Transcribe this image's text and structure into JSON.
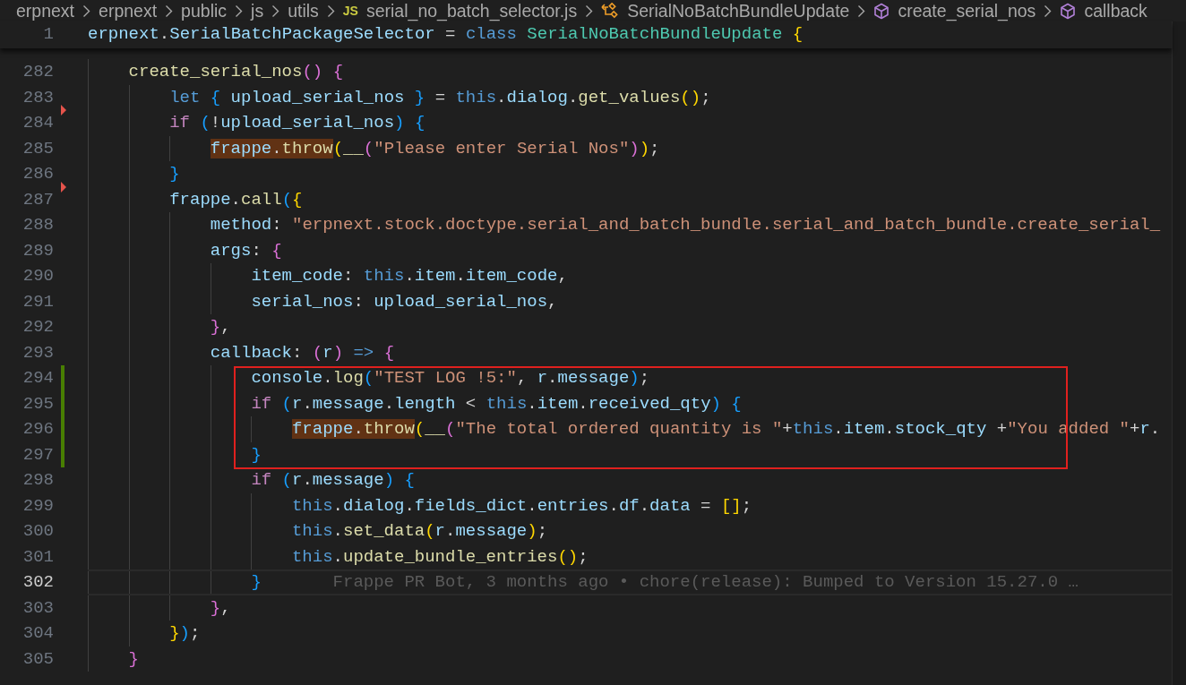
{
  "breadcrumb": [
    {
      "label": "erpnext",
      "kind": "folder"
    },
    {
      "label": "erpnext",
      "kind": "folder"
    },
    {
      "label": "public",
      "kind": "folder"
    },
    {
      "label": "js",
      "kind": "folder"
    },
    {
      "label": "utils",
      "kind": "folder"
    },
    {
      "label": "serial_no_batch_selector.js",
      "kind": "file",
      "badge": "JS"
    },
    {
      "label": "SerialNoBatchBundleUpdate",
      "kind": "class"
    },
    {
      "label": "create_serial_nos",
      "kind": "method"
    },
    {
      "label": "callback",
      "kind": "method"
    }
  ],
  "sticky_line": {
    "number": "1",
    "tokens": [
      {
        "text": "erpnext",
        "kind": "var"
      },
      {
        "text": ".",
        "kind": "op"
      },
      {
        "text": "SerialBatchPackageSelector",
        "kind": "var"
      },
      {
        "text": " = ",
        "kind": "op"
      },
      {
        "text": "class ",
        "kind": "kw"
      },
      {
        "text": "SerialNoBatchBundleUpdate ",
        "kind": "cls"
      },
      {
        "text": "{",
        "kind": "b1"
      }
    ]
  },
  "lines": [
    {
      "number": "282",
      "changed": false,
      "deleted_above": false,
      "current": false,
      "boxed": false,
      "tokens": [
        {
          "text": "create_serial_nos",
          "kind": "fn"
        },
        {
          "text": "() ",
          "kind": "b2"
        },
        {
          "text": "{",
          "kind": "b2"
        }
      ],
      "children": [
        {
          "number": "283",
          "changed": false,
          "deleted_above": false,
          "current": false,
          "boxed": false,
          "tokens": [
            {
              "text": "let ",
              "kind": "kw"
            },
            {
              "text": "{ ",
              "kind": "b3"
            },
            {
              "text": "upload_serial_nos ",
              "kind": "var"
            },
            {
              "text": "}",
              "kind": "b3"
            },
            {
              "text": " = ",
              "kind": "op"
            },
            {
              "text": "this",
              "kind": "kw"
            },
            {
              "text": ".",
              "kind": "op"
            },
            {
              "text": "dialog",
              "kind": "var"
            },
            {
              "text": ".",
              "kind": "op"
            },
            {
              "text": "get_values",
              "kind": "fn"
            },
            {
              "text": "()",
              "kind": "b1"
            },
            {
              "text": ";",
              "kind": "op"
            }
          ]
        },
        {
          "number": "284",
          "changed": false,
          "deleted_above": true,
          "current": false,
          "boxed": false,
          "tokens": [
            {
              "text": "if ",
              "kind": "ctrl"
            },
            {
              "text": "(",
              "kind": "b3"
            },
            {
              "text": "!",
              "kind": "op"
            },
            {
              "text": "upload_serial_nos",
              "kind": "var"
            },
            {
              "text": ") ",
              "kind": "b3"
            },
            {
              "text": "{",
              "kind": "b3"
            }
          ],
          "children": [
            {
              "number": "285",
              "changed": false,
              "deleted_above": false,
              "current": false,
              "boxed": false,
              "tokens": [
                {
                  "kind": "group",
                  "highlighted": true,
                  "tokens": [
                    {
                      "text": "frappe",
                      "kind": "var"
                    },
                    {
                      "text": ".",
                      "kind": "op"
                    },
                    {
                      "text": "throw",
                      "kind": "fn"
                    }
                  ]
                },
                {
                  "text": "(",
                  "kind": "b1"
                },
                {
                  "text": "__",
                  "kind": "fn"
                },
                {
                  "text": "(",
                  "kind": "b2"
                },
                {
                  "text": "\"Please enter Serial Nos\"",
                  "kind": "str"
                },
                {
                  "text": ")",
                  "kind": "b2"
                },
                {
                  "text": ")",
                  "kind": "b1"
                },
                {
                  "text": ";",
                  "kind": "op"
                }
              ]
            }
          ]
        },
        {
          "number": "286",
          "changed": false,
          "deleted_above": false,
          "current": false,
          "boxed": false,
          "tokens": [
            {
              "text": "}",
              "kind": "b3"
            }
          ]
        },
        {
          "number": "287",
          "changed": false,
          "deleted_above": true,
          "current": false,
          "boxed": false,
          "tokens": [
            {
              "text": "frappe",
              "kind": "var"
            },
            {
              "text": ".",
              "kind": "op"
            },
            {
              "text": "call",
              "kind": "fn"
            },
            {
              "text": "(",
              "kind": "b3"
            },
            {
              "text": "{",
              "kind": "b1"
            }
          ],
          "children": [
            {
              "number": "288",
              "changed": false,
              "deleted_above": false,
              "current": false,
              "boxed": false,
              "tokens": [
                {
                  "text": "method",
                  "kind": "var"
                },
                {
                  "text": ": ",
                  "kind": "op"
                },
                {
                  "text": "\"erpnext.stock.doctype.serial_and_batch_bundle.serial_and_batch_bundle.create_serial_",
                  "kind": "str"
                }
              ]
            },
            {
              "number": "289",
              "changed": false,
              "deleted_above": false,
              "current": false,
              "boxed": false,
              "tokens": [
                {
                  "text": "args",
                  "kind": "var"
                },
                {
                  "text": ": ",
                  "kind": "op"
                },
                {
                  "text": "{",
                  "kind": "b2"
                }
              ],
              "children": [
                {
                  "number": "290",
                  "changed": false,
                  "deleted_above": false,
                  "current": false,
                  "boxed": false,
                  "tokens": [
                    {
                      "text": "item_code",
                      "kind": "var"
                    },
                    {
                      "text": ": ",
                      "kind": "op"
                    },
                    {
                      "text": "this",
                      "kind": "kw"
                    },
                    {
                      "text": ".",
                      "kind": "op"
                    },
                    {
                      "text": "item",
                      "kind": "var"
                    },
                    {
                      "text": ".",
                      "kind": "op"
                    },
                    {
                      "text": "item_code",
                      "kind": "var"
                    },
                    {
                      "text": ",",
                      "kind": "op"
                    }
                  ]
                },
                {
                  "number": "291",
                  "changed": false,
                  "deleted_above": false,
                  "current": false,
                  "boxed": false,
                  "tokens": [
                    {
                      "text": "serial_nos",
                      "kind": "var"
                    },
                    {
                      "text": ": ",
                      "kind": "op"
                    },
                    {
                      "text": "upload_serial_nos",
                      "kind": "var"
                    },
                    {
                      "text": ",",
                      "kind": "op"
                    }
                  ]
                }
              ]
            },
            {
              "number": "292",
              "changed": false,
              "deleted_above": false,
              "current": false,
              "boxed": false,
              "tokens": [
                {
                  "text": "}",
                  "kind": "b2"
                },
                {
                  "text": ",",
                  "kind": "op"
                }
              ]
            },
            {
              "number": "293",
              "changed": false,
              "deleted_above": false,
              "current": false,
              "boxed": false,
              "tokens": [
                {
                  "text": "callback",
                  "kind": "var"
                },
                {
                  "text": ": ",
                  "kind": "op"
                },
                {
                  "text": "(",
                  "kind": "b2"
                },
                {
                  "text": "r",
                  "kind": "var"
                },
                {
                  "text": ") ",
                  "kind": "b2"
                },
                {
                  "text": "=> ",
                  "kind": "kw"
                },
                {
                  "text": "{",
                  "kind": "b2"
                }
              ],
              "children": [
                {
                  "number": "294",
                  "changed": true,
                  "deleted_above": false,
                  "current": false,
                  "boxed": true,
                  "tokens": [
                    {
                      "text": "console",
                      "kind": "var"
                    },
                    {
                      "text": ".",
                      "kind": "op"
                    },
                    {
                      "text": "log",
                      "kind": "fn"
                    },
                    {
                      "text": "(",
                      "kind": "b3"
                    },
                    {
                      "text": "\"TEST LOG !5:\"",
                      "kind": "str"
                    },
                    {
                      "text": ", ",
                      "kind": "op"
                    },
                    {
                      "text": "r",
                      "kind": "var"
                    },
                    {
                      "text": ".",
                      "kind": "op"
                    },
                    {
                      "text": "message",
                      "kind": "var"
                    },
                    {
                      "text": ")",
                      "kind": "b3"
                    },
                    {
                      "text": ";",
                      "kind": "op"
                    }
                  ]
                },
                {
                  "number": "295",
                  "changed": true,
                  "deleted_above": false,
                  "current": false,
                  "boxed": true,
                  "tokens": [
                    {
                      "text": "if ",
                      "kind": "ctrl"
                    },
                    {
                      "text": "(",
                      "kind": "b3"
                    },
                    {
                      "text": "r",
                      "kind": "var"
                    },
                    {
                      "text": ".",
                      "kind": "op"
                    },
                    {
                      "text": "message",
                      "kind": "var"
                    },
                    {
                      "text": ".",
                      "kind": "op"
                    },
                    {
                      "text": "length",
                      "kind": "var"
                    },
                    {
                      "text": " < ",
                      "kind": "op"
                    },
                    {
                      "text": "this",
                      "kind": "kw"
                    },
                    {
                      "text": ".",
                      "kind": "op"
                    },
                    {
                      "text": "item",
                      "kind": "var"
                    },
                    {
                      "text": ".",
                      "kind": "op"
                    },
                    {
                      "text": "received_qty",
                      "kind": "var"
                    },
                    {
                      "text": ") ",
                      "kind": "b3"
                    },
                    {
                      "text": "{",
                      "kind": "b3"
                    }
                  ],
                  "children": [
                    {
                      "number": "296",
                      "changed": true,
                      "deleted_above": false,
                      "current": false,
                      "boxed": true,
                      "tokens": [
                        {
                          "kind": "group",
                          "highlighted": true,
                          "tokens": [
                            {
                              "text": "frappe",
                              "kind": "var"
                            },
                            {
                              "text": ".",
                              "kind": "op"
                            },
                            {
                              "text": "throw",
                              "kind": "fn"
                            }
                          ]
                        },
                        {
                          "text": "(",
                          "kind": "b1"
                        },
                        {
                          "text": "__",
                          "kind": "fn"
                        },
                        {
                          "text": "(",
                          "kind": "b2"
                        },
                        {
                          "text": "\"The total ordered quantity is \"",
                          "kind": "str"
                        },
                        {
                          "text": "+",
                          "kind": "op"
                        },
                        {
                          "text": "this",
                          "kind": "kw"
                        },
                        {
                          "text": ".",
                          "kind": "op"
                        },
                        {
                          "text": "item",
                          "kind": "var"
                        },
                        {
                          "text": ".",
                          "kind": "op"
                        },
                        {
                          "text": "stock_qty",
                          "kind": "var"
                        },
                        {
                          "text": " +",
                          "kind": "op"
                        },
                        {
                          "text": "\"You added \"",
                          "kind": "str"
                        },
                        {
                          "text": "+",
                          "kind": "op"
                        },
                        {
                          "text": "r",
                          "kind": "var"
                        },
                        {
                          "text": ".",
                          "kind": "op"
                        }
                      ]
                    }
                  ]
                },
                {
                  "number": "297",
                  "changed": true,
                  "deleted_above": false,
                  "current": false,
                  "boxed": true,
                  "tokens": [
                    {
                      "text": "}",
                      "kind": "b3"
                    }
                  ]
                },
                {
                  "number": "298",
                  "changed": false,
                  "deleted_above": false,
                  "current": false,
                  "boxed": false,
                  "tokens": [
                    {
                      "text": "if ",
                      "kind": "ctrl"
                    },
                    {
                      "text": "(",
                      "kind": "b3"
                    },
                    {
                      "text": "r",
                      "kind": "var"
                    },
                    {
                      "text": ".",
                      "kind": "op"
                    },
                    {
                      "text": "message",
                      "kind": "var"
                    },
                    {
                      "text": ") ",
                      "kind": "b3"
                    },
                    {
                      "text": "{",
                      "kind": "b3"
                    }
                  ],
                  "children": [
                    {
                      "number": "299",
                      "changed": false,
                      "deleted_above": false,
                      "current": false,
                      "boxed": false,
                      "tokens": [
                        {
                          "text": "this",
                          "kind": "kw"
                        },
                        {
                          "text": ".",
                          "kind": "op"
                        },
                        {
                          "text": "dialog",
                          "kind": "var"
                        },
                        {
                          "text": ".",
                          "kind": "op"
                        },
                        {
                          "text": "fields_dict",
                          "kind": "var"
                        },
                        {
                          "text": ".",
                          "kind": "op"
                        },
                        {
                          "text": "entries",
                          "kind": "var"
                        },
                        {
                          "text": ".",
                          "kind": "op"
                        },
                        {
                          "text": "df",
                          "kind": "var"
                        },
                        {
                          "text": ".",
                          "kind": "op"
                        },
                        {
                          "text": "data",
                          "kind": "var"
                        },
                        {
                          "text": " = ",
                          "kind": "op"
                        },
                        {
                          "text": "[]",
                          "kind": "b1"
                        },
                        {
                          "text": ";",
                          "kind": "op"
                        }
                      ]
                    },
                    {
                      "number": "300",
                      "changed": false,
                      "deleted_above": false,
                      "current": false,
                      "boxed": false,
                      "tokens": [
                        {
                          "text": "this",
                          "kind": "kw"
                        },
                        {
                          "text": ".",
                          "kind": "op"
                        },
                        {
                          "text": "set_data",
                          "kind": "fn"
                        },
                        {
                          "text": "(",
                          "kind": "b1"
                        },
                        {
                          "text": "r",
                          "kind": "var"
                        },
                        {
                          "text": ".",
                          "kind": "op"
                        },
                        {
                          "text": "message",
                          "kind": "var"
                        },
                        {
                          "text": ")",
                          "kind": "b1"
                        },
                        {
                          "text": ";",
                          "kind": "op"
                        }
                      ]
                    },
                    {
                      "number": "301",
                      "changed": false,
                      "deleted_above": false,
                      "current": false,
                      "boxed": false,
                      "tokens": [
                        {
                          "text": "this",
                          "kind": "kw"
                        },
                        {
                          "text": ".",
                          "kind": "op"
                        },
                        {
                          "text": "update_bundle_entries",
                          "kind": "fn"
                        },
                        {
                          "text": "()",
                          "kind": "b1"
                        },
                        {
                          "text": ";",
                          "kind": "op"
                        }
                      ]
                    }
                  ]
                },
                {
                  "number": "302",
                  "changed": false,
                  "deleted_above": false,
                  "current": true,
                  "boxed": false,
                  "blame": "Frappe PR Bot, 3 months ago • chore(release): Bumped to Version 15.27.0 …",
                  "tokens": [
                    {
                      "text": "}",
                      "kind": "b3"
                    }
                  ]
                }
              ]
            },
            {
              "number": "303",
              "changed": false,
              "deleted_above": false,
              "current": false,
              "boxed": false,
              "tokens": [
                {
                  "text": "}",
                  "kind": "b2"
                },
                {
                  "text": ",",
                  "kind": "op"
                }
              ]
            }
          ]
        },
        {
          "number": "304",
          "changed": false,
          "deleted_above": false,
          "current": false,
          "boxed": false,
          "tokens": [
            {
              "text": "}",
              "kind": "b1"
            },
            {
              "text": ")",
              "kind": "b3"
            },
            {
              "text": ";",
              "kind": "op"
            }
          ]
        }
      ]
    },
    {
      "number": "305",
      "changed": false,
      "deleted_above": false,
      "current": false,
      "boxed": false,
      "tokens": [
        {
          "text": "}",
          "kind": "b2"
        }
      ]
    }
  ]
}
